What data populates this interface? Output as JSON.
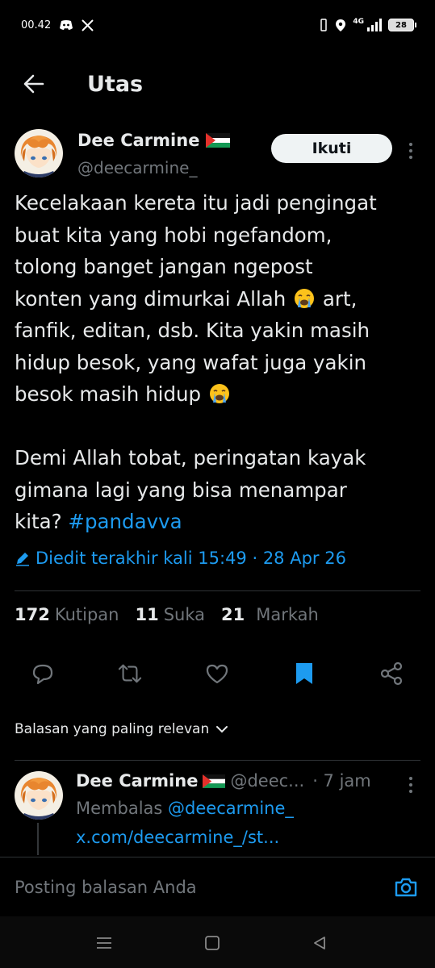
{
  "status_bar": {
    "time": "00.42",
    "network": "4G",
    "battery": "28"
  },
  "header": {
    "title": "Utas"
  },
  "tweet": {
    "author_name": "Dee Carmine",
    "author_handle": "@deecarmine_",
    "follow_label": "Ikuti",
    "lines": [
      "Kecelakaan kereta itu jadi pengingat",
      "buat kita yang hobi ngefandom,",
      "tolong banget jangan ngepost",
      "konten yang dimurkai Allah",
      "art,",
      "fanfik, editan, dsb. Kita yakin masih",
      "hidup besok, yang wafat juga yakin",
      "besok masih hidup",
      "Demi Allah tobat, peringatan kayak",
      "gimana lagi yang bisa menampar",
      "kita?",
      "#pandavva"
    ],
    "edited_text": "Diedit terakhir kali 15:49 · 28 Apr 26"
  },
  "stats": {
    "quotes_count": "172",
    "quotes_label": "Kutipan",
    "likes_count": "11",
    "likes_label": "Suka",
    "bookmarks_count": "21",
    "bookmarks_label": "Markah"
  },
  "sort": {
    "label": "Balasan yang paling relevan"
  },
  "reply": {
    "author_name": "Dee Carmine",
    "author_handle": "@deec...",
    "time": "· 7 jam",
    "replying_prefix": "Membalas",
    "replying_to": "@deecarmine_",
    "link": "x.com/deecarmine_/st..."
  },
  "composer": {
    "placeholder": "Posting balasan Anda"
  },
  "colors": {
    "accent": "#1d9bf0",
    "background": "#000000",
    "text": "#e7e9ea",
    "muted": "#71767b",
    "divider": "#2f3336"
  },
  "icons": {
    "back": "arrow-left-icon",
    "flag": "palestine-flag-icon",
    "more": "more-vertical-icon",
    "crying_emoji": "loudly-crying-face-icon",
    "edit": "pencil-icon",
    "reply": "comment-icon",
    "retweet": "retweet-icon",
    "like": "heart-icon",
    "bookmark": "bookmark-filled-icon",
    "share": "share-icon",
    "chevron": "chevron-down-icon",
    "camera": "camera-icon"
  }
}
